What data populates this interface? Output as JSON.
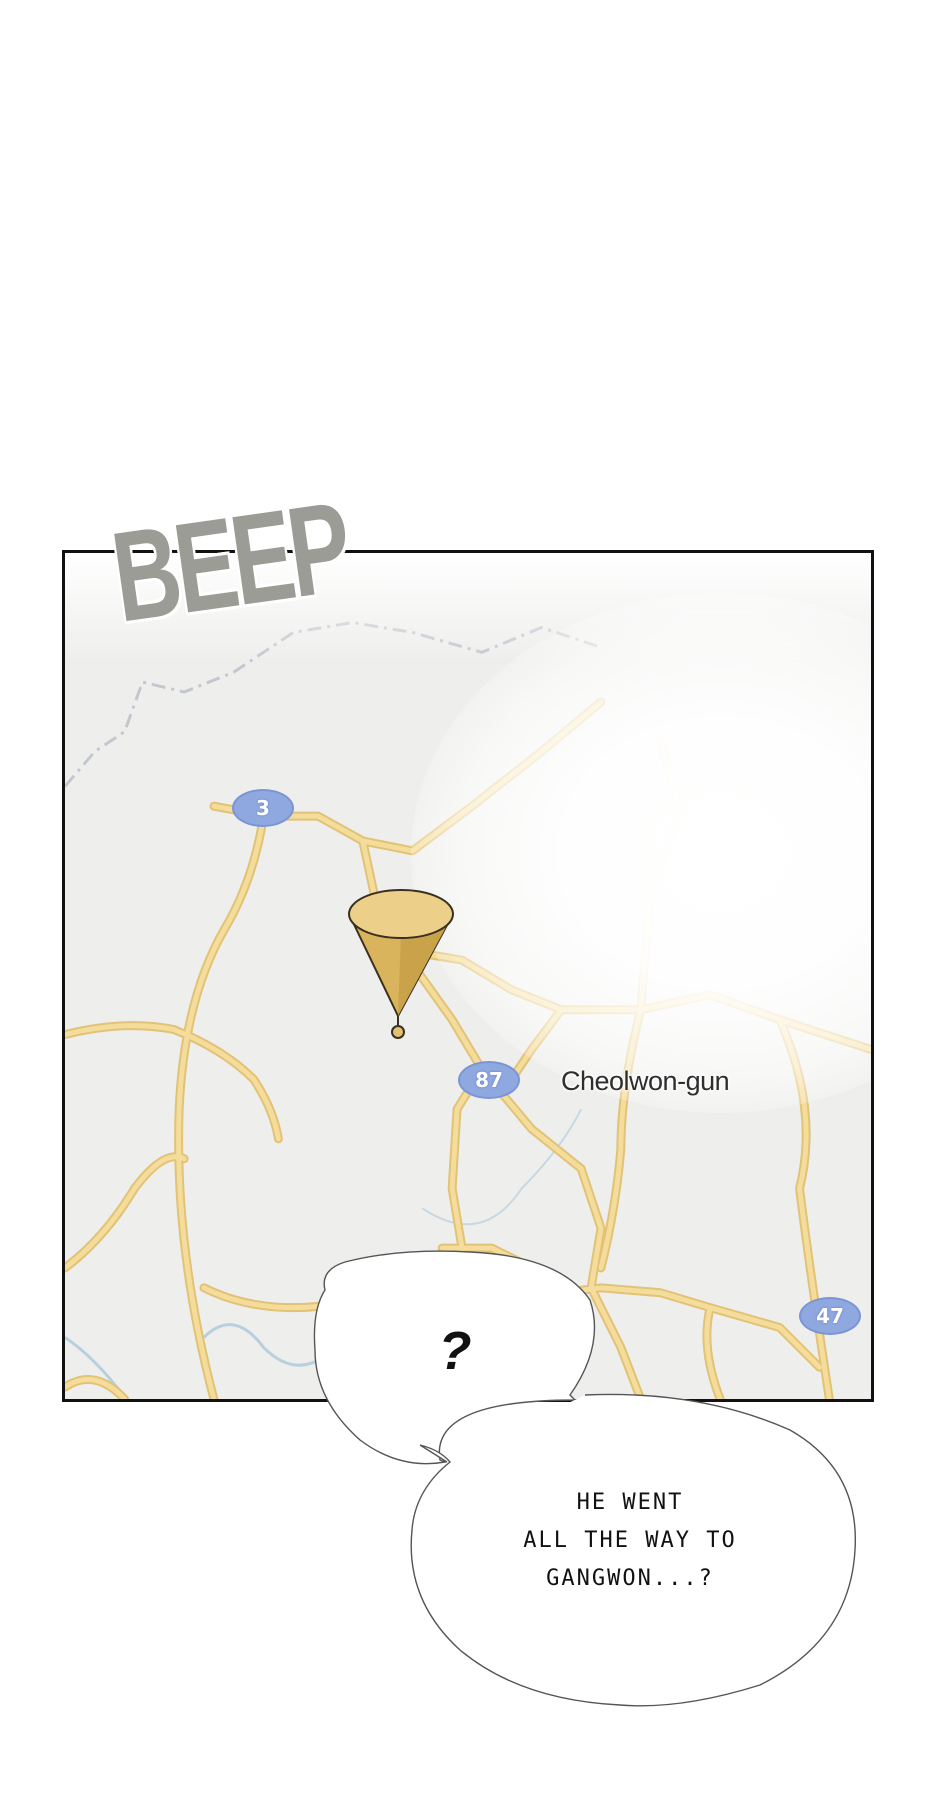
{
  "sound_effect": "BEEP",
  "map": {
    "place_label": "Cheolwon-gun",
    "route_badges": [
      "3",
      "87",
      "47"
    ],
    "pin_color": "#e8c978",
    "road_color": "#f0d68f",
    "water_color": "#bcd3e0",
    "border_color": "#c0c4cc"
  },
  "bubbles": {
    "question": "?",
    "speech_lines": [
      "HE WENT",
      "ALL THE WAY TO",
      "GANGWON...?"
    ]
  }
}
